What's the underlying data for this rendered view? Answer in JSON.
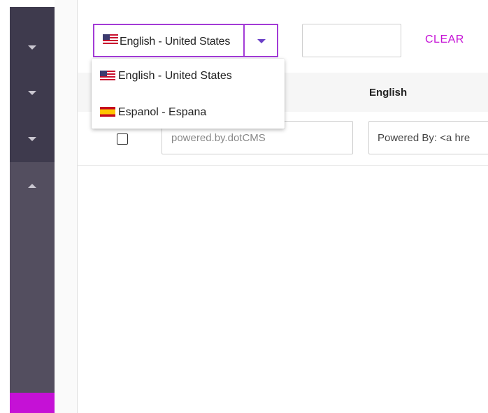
{
  "language_selector": {
    "selected_label": "English - United States",
    "selected_flag": "us-flag-icon",
    "options": [
      {
        "label": "English - United States",
        "flag": "us-flag-icon"
      },
      {
        "label": "Espanol - Espana",
        "flag": "es-flag-icon"
      }
    ]
  },
  "toolbar": {
    "filter_value": "",
    "clear_label": "CLEAR"
  },
  "table": {
    "columns": [
      "English"
    ],
    "rows": [
      {
        "key": "powered.by.dotCMS",
        "english_value": "Powered By: <a hre"
      }
    ]
  },
  "colors": {
    "accent": "#c511d6",
    "selector_border": "#a23bd6",
    "sidebar_dark": "#3e3a4d",
    "sidebar_mid": "#534e5f"
  }
}
